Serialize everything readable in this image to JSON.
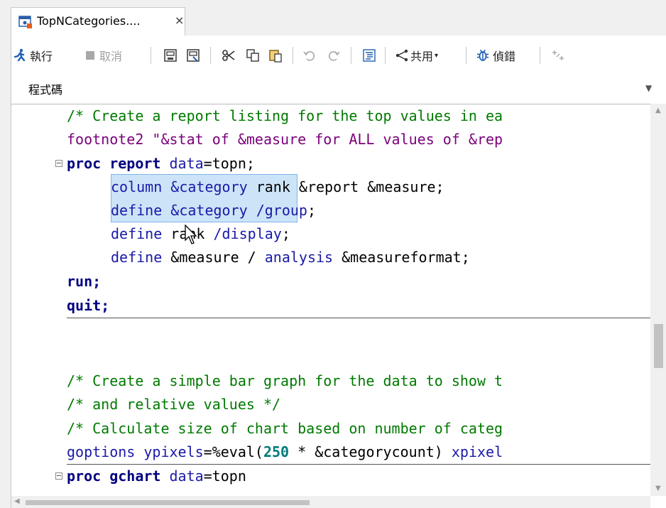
{
  "tab": {
    "title": "TopNCategories....",
    "close": "×"
  },
  "toolbar": {
    "run": "執行",
    "cancel": "取消",
    "share": "共用",
    "debug": "偵錯"
  },
  "subtab": {
    "code": "程式碼"
  },
  "code": {
    "l1": "/* Create a report listing for the top values in ea",
    "l2": "footnote2 \"&stat of &measure for ALL values of &rep",
    "l3a": "proc report",
    "l3b": " data",
    "l3c": "=topn;",
    "l4a": "column &category",
    "l4b": " rank &report &measure;",
    "l5a": "define &category",
    "l5b": " /group",
    "l5c": ";",
    "l6a": "define",
    "l6b": " rank ",
    "l6c": "/display",
    "l6d": ";",
    "l7a": "define",
    "l7b": " &measure / ",
    "l7c": "analysis",
    "l7d": " &measureformat;",
    "l8": "run;",
    "l9": "quit;",
    "l10": "/* Create a simple bar graph for the data to show t",
    "l11": "/* and relative values */",
    "l12": "/* Calculate size of chart based on number of categ",
    "l13a": "goptions ypixels",
    "l13b": "=%eval(",
    "l13c": "250",
    "l13d": " * &categorycount) ",
    "l13e": "xpixel",
    "l14a": "proc gchart",
    "l14b": " data",
    "l14c": "=topn"
  },
  "colors": {
    "accent": "#1e5fb4",
    "selection": "#cce4f7",
    "comment": "#007a00",
    "keyword": "#1a1aa8"
  }
}
